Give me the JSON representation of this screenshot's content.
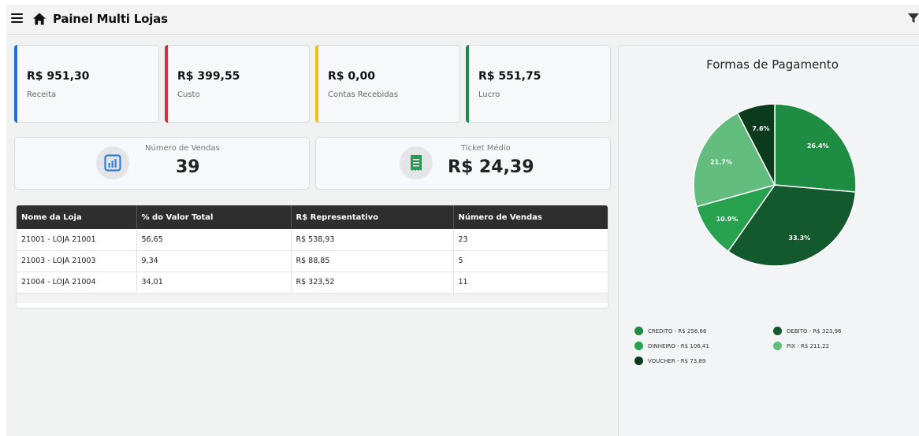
{
  "header": {
    "title": "Painel Multi Lojas"
  },
  "kpis": [
    {
      "value": "R$ 951,30",
      "label": "Receita",
      "color": "#1c6fe0"
    },
    {
      "value": "R$ 399,55",
      "label": "Custo",
      "color": "#d6303e"
    },
    {
      "value": "R$ 0,00",
      "label": "Contas Recebidas",
      "color": "#f0bd12"
    },
    {
      "value": "R$ 551,75",
      "label": "Lucro",
      "color": "#1b8a48"
    }
  ],
  "stats": {
    "vendas": {
      "label": "Número de Vendas",
      "value": "39",
      "icon": "bar-chart-icon",
      "color": "#2f7fd1"
    },
    "ticket": {
      "label": "Ticket Médio",
      "value": "R$ 24,39",
      "icon": "receipt-icon",
      "color": "#2a9a52"
    }
  },
  "table": {
    "headers": [
      "Nome da Loja",
      "% do Valor Total",
      "R$ Representativo",
      "Número de Vendas"
    ],
    "rows": [
      [
        "21001 - LOJA 21001",
        "56,65",
        "R$ 538,93",
        "23"
      ],
      [
        "21003 - LOJA 21003",
        "9,34",
        "R$ 88,85",
        "5"
      ],
      [
        "21004 - LOJA 21004",
        "34,01",
        "R$ 323,52",
        "11"
      ]
    ]
  },
  "chart_data": {
    "type": "pie",
    "title": "Formas de Pagamento",
    "slices": [
      {
        "label": "CREDITO - R$ 256,66",
        "value": 256.66,
        "percent": "26.4%",
        "color": "#1f8c43"
      },
      {
        "label": "DEBITO - R$ 323,96",
        "value": 323.96,
        "percent": "33.3%",
        "color": "#14592d"
      },
      {
        "label": "DINHEIRO - R$ 106,41",
        "value": 106.41,
        "percent": "10.9%",
        "color": "#28a24e"
      },
      {
        "label": "PIX - R$ 211,22",
        "value": 211.22,
        "percent": "21.7%",
        "color": "#62bd7e"
      },
      {
        "label": "VOUCHER - R$ 73,89",
        "value": 73.89,
        "percent": "7.6%",
        "color": "#0c3a1c"
      }
    ]
  }
}
